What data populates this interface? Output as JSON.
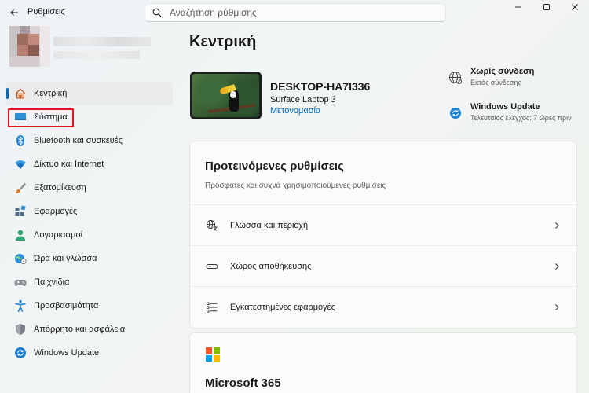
{
  "window": {
    "title": "Ρυθμίσεις"
  },
  "search": {
    "placeholder": "Αναζήτηση ρύθμισης"
  },
  "sidebar": {
    "items": [
      {
        "label": "Κεντρική",
        "icon": "home-icon"
      },
      {
        "label": "Σύστημα",
        "icon": "system-icon"
      },
      {
        "label": "Bluetooth και συσκευές",
        "icon": "bluetooth-icon"
      },
      {
        "label": "Δίκτυο και Internet",
        "icon": "wifi-icon"
      },
      {
        "label": "Εξατομίκευση",
        "icon": "brush-icon"
      },
      {
        "label": "Εφαρμογές",
        "icon": "apps-icon"
      },
      {
        "label": "Λογαριασμοί",
        "icon": "account-icon"
      },
      {
        "label": "Ώρα και γλώσσα",
        "icon": "time-language-icon"
      },
      {
        "label": "Παιχνίδια",
        "icon": "gamepad-icon"
      },
      {
        "label": "Προσβασιμότητα",
        "icon": "accessibility-icon"
      },
      {
        "label": "Απόρρητο και ασφάλεια",
        "icon": "shield-icon"
      },
      {
        "label": "Windows Update",
        "icon": "update-icon"
      }
    ]
  },
  "main": {
    "title": "Κεντρική",
    "device": {
      "name": "DESKTOP-HA7I336",
      "model": "Surface Laptop 3",
      "rename": "Μετονομασία"
    },
    "status": [
      {
        "title": "Χωρίς σύνδεση",
        "subtitle": "Εκτός σύνδεσης",
        "icon": "globe-icon"
      },
      {
        "title": "Windows Update",
        "subtitle": "Τελευταίος έλεγχος: 7 ώρες πριν",
        "icon": "update-icon"
      }
    ],
    "recommended": {
      "title": "Προτεινόμενες ρυθμίσεις",
      "subtitle": "Πρόσφατες και συχνά χρησιμοποιούμενες ρυθμίσεις",
      "rows": [
        {
          "label": "Γλώσσα και περιοχή",
          "icon": "language-icon"
        },
        {
          "label": "Χώρος αποθήκευσης",
          "icon": "storage-icon"
        },
        {
          "label": "Εγκατεστημένες εφαρμογές",
          "icon": "installed-apps-icon"
        }
      ]
    },
    "m365": {
      "title": "Microsoft 365"
    }
  },
  "colors": {
    "accent": "#0067c0",
    "highlight": "#e81123"
  }
}
